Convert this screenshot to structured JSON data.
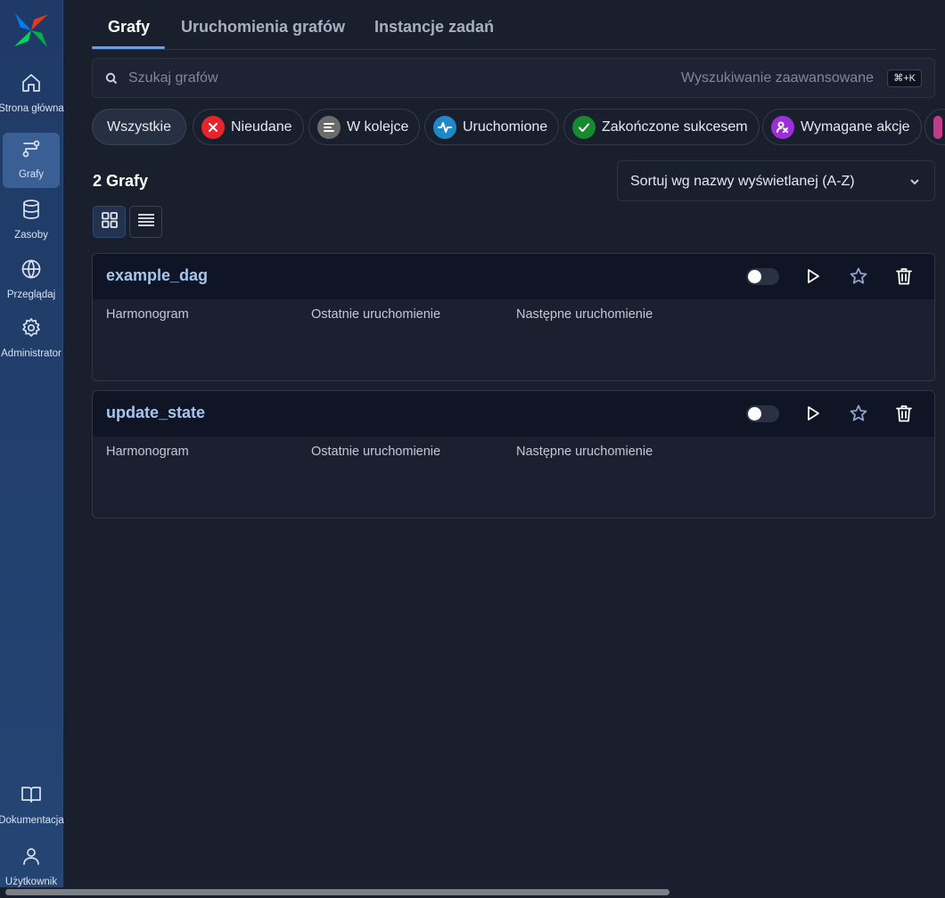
{
  "sidebar": {
    "items": [
      {
        "label": "Strona główna",
        "icon": "home-icon"
      },
      {
        "label": "Grafy",
        "icon": "dags-icon",
        "active": true
      },
      {
        "label": "Zasoby",
        "icon": "database-icon"
      },
      {
        "label": "Przeglądaj",
        "icon": "globe-icon"
      },
      {
        "label": "Administrator",
        "icon": "gear-icon"
      }
    ],
    "bottom": [
      {
        "label": "Dokumentacja",
        "icon": "book-icon"
      },
      {
        "label": "Użytkownik",
        "icon": "user-icon"
      }
    ]
  },
  "tabs": [
    {
      "label": "Grafy",
      "active": true
    },
    {
      "label": "Uruchomienia grafów"
    },
    {
      "label": "Instancje zadań"
    }
  ],
  "search": {
    "placeholder": "Szukaj grafów",
    "advanced_label": "Wyszukiwanie zaawansowane",
    "shortcut": "⌘+K"
  },
  "filters": [
    {
      "label": "Wszystkie",
      "active": true
    },
    {
      "label": "Nieudane",
      "color": "#e5252a",
      "icon": "x-icon"
    },
    {
      "label": "W kolejce",
      "color": "#6b6b6b",
      "icon": "queue-icon"
    },
    {
      "label": "Uruchomione",
      "color": "#1e88c8",
      "icon": "activity-icon"
    },
    {
      "label": "Zakończone sukcesem",
      "color": "#178a2f",
      "icon": "check-icon"
    },
    {
      "label": "Wymagane akcje",
      "color": "#9b2fd9",
      "icon": "hand-icon"
    }
  ],
  "list": {
    "count_label": "2 Grafy",
    "sort_value": "Sortuj wg nazwy wyświetlanej (A-Z)"
  },
  "columns": {
    "schedule": "Harmonogram",
    "last_run": "Ostatnie uruchomienie",
    "next_run": "Następne uruchomienie"
  },
  "dags": [
    {
      "name": "example_dag",
      "paused": true
    },
    {
      "name": "update_state",
      "paused": true
    }
  ]
}
